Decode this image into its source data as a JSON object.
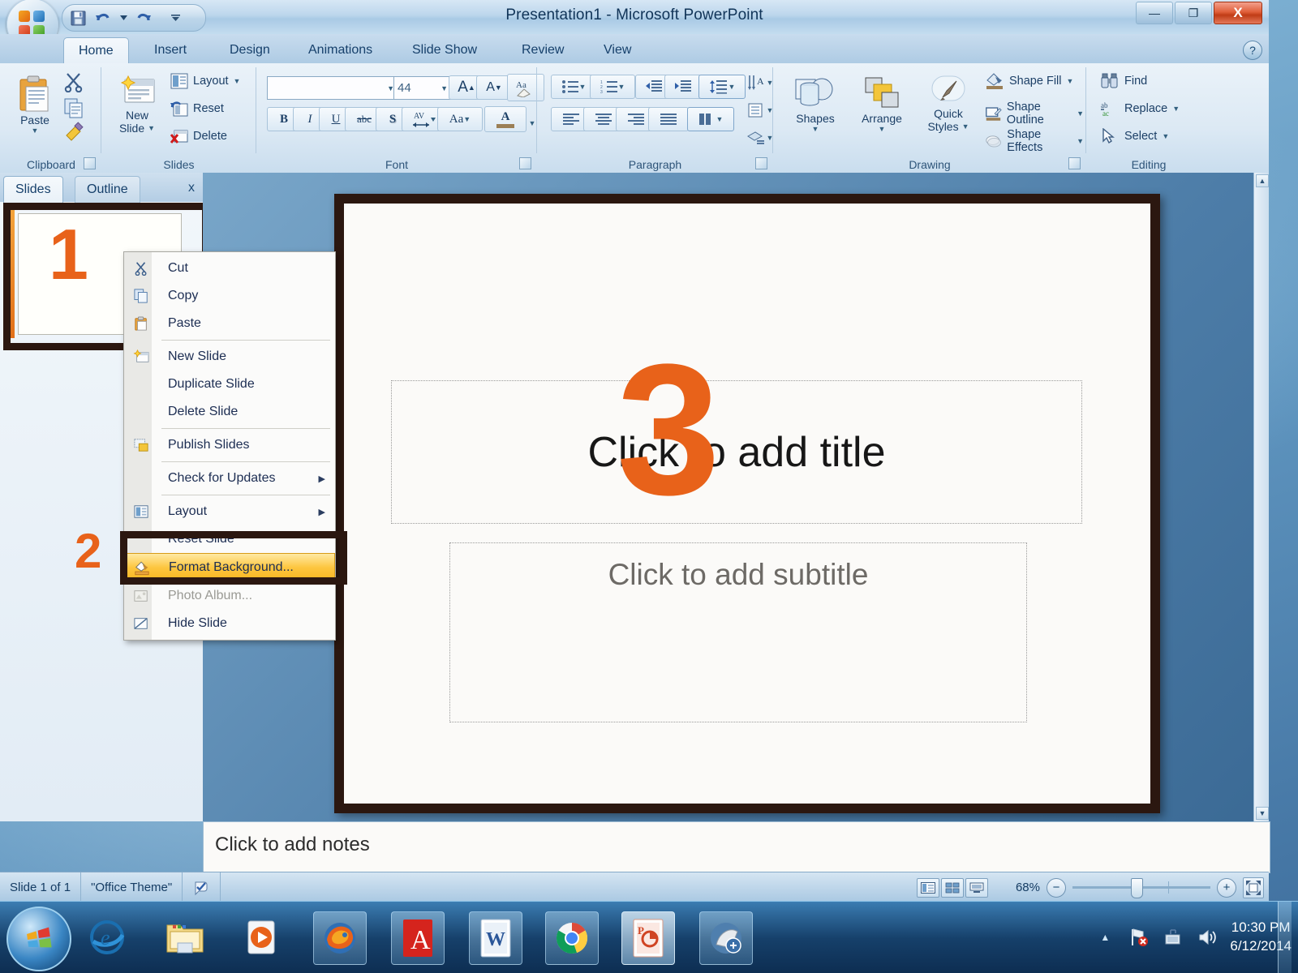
{
  "window": {
    "title": "Presentation1 - Microsoft PowerPoint",
    "minimize_label": "—",
    "restore_label": "❐",
    "close_label": "X",
    "help_label": "?"
  },
  "quick_access": {
    "items": [
      {
        "name": "save-icon",
        "label": "💾"
      },
      {
        "name": "undo-icon",
        "label": "↶"
      },
      {
        "name": "undo-dropdown-icon",
        "label": "▾"
      },
      {
        "name": "redo-icon",
        "label": "↷"
      },
      {
        "name": "customize-qat-icon",
        "label": "▾"
      }
    ]
  },
  "ribbon": {
    "tabs": [
      {
        "label": "Home",
        "active": true
      },
      {
        "label": "Insert",
        "active": false
      },
      {
        "label": "Design",
        "active": false
      },
      {
        "label": "Animations",
        "active": false
      },
      {
        "label": "Slide Show",
        "active": false
      },
      {
        "label": "Review",
        "active": false
      },
      {
        "label": "View",
        "active": false
      }
    ],
    "groups": {
      "clipboard": {
        "label": "Clipboard",
        "paste_label": "Paste",
        "cut_label": "Cut",
        "copy_label": "Copy",
        "format_painter_label": "Format Painter"
      },
      "slides": {
        "label": "Slides",
        "new_slide_line1": "New",
        "new_slide_line2": "Slide",
        "layout_label": "Layout",
        "reset_label": "Reset",
        "delete_label": "Delete"
      },
      "font": {
        "label": "Font",
        "font_name_value": "",
        "font_name_placeholder": "",
        "font_size_value": "44",
        "grow_font_label": "A",
        "shrink_font_label": "A",
        "clear_formatting_label": "Aa",
        "bold_label": "B",
        "italic_label": "I",
        "underline_label": "U",
        "strikethrough_label": "abc",
        "shadow_label": "S",
        "spacing_label": "AV",
        "change_case_label": "Aa",
        "font_color_label": "A"
      },
      "paragraph": {
        "label": "Paragraph"
      },
      "drawing": {
        "label": "Drawing",
        "shapes_label": "Shapes",
        "arrange_label": "Arrange",
        "quick_styles_line1": "Quick",
        "quick_styles_line2": "Styles",
        "shape_fill_label": "Shape Fill",
        "shape_outline_label": "Shape Outline",
        "shape_effects_label": "Shape Effects"
      },
      "editing": {
        "label": "Editing",
        "find_label": "Find",
        "replace_label": "Replace",
        "select_label": "Select"
      }
    }
  },
  "slide_panel": {
    "tabs": [
      {
        "label": "Slides",
        "active": true
      },
      {
        "label": "Outline",
        "active": false
      }
    ],
    "close_label": "x",
    "thumbnail_number": "1"
  },
  "context_menu": {
    "items": [
      {
        "label": "Cut",
        "icon": "scissors-icon",
        "glyph": "✂",
        "separator_after": false,
        "highlight": false,
        "submenu": false,
        "dim": false
      },
      {
        "label": "Copy",
        "icon": "copy-icon",
        "glyph": "⧉",
        "separator_after": false,
        "highlight": false,
        "submenu": false,
        "dim": false
      },
      {
        "label": "Paste",
        "icon": "paste-icon",
        "glyph": "📋",
        "separator_after": true,
        "highlight": false,
        "submenu": false,
        "dim": false
      },
      {
        "label": "New Slide",
        "icon": "new-slide-icon",
        "glyph": "❖",
        "separator_after": false,
        "highlight": false,
        "submenu": false,
        "dim": false
      },
      {
        "label": "Duplicate Slide",
        "icon": "",
        "glyph": "",
        "separator_after": false,
        "highlight": false,
        "submenu": false,
        "dim": false
      },
      {
        "label": "Delete Slide",
        "icon": "",
        "glyph": "",
        "separator_after": true,
        "highlight": false,
        "submenu": false,
        "dim": false
      },
      {
        "label": "Publish Slides",
        "icon": "publish-slides-icon",
        "glyph": "▤",
        "separator_after": true,
        "highlight": false,
        "submenu": false,
        "dim": false
      },
      {
        "label": "Check for Updates",
        "icon": "",
        "glyph": "",
        "separator_after": true,
        "highlight": false,
        "submenu": true,
        "dim": false
      },
      {
        "label": "Layout",
        "icon": "layout-icon",
        "glyph": "▥",
        "separator_after": false,
        "highlight": false,
        "submenu": true,
        "dim": false
      },
      {
        "label": "Reset Slide",
        "icon": "",
        "glyph": "",
        "separator_after": false,
        "highlight": false,
        "submenu": false,
        "dim": false
      },
      {
        "label": "Format Background...",
        "icon": "format-background-icon",
        "glyph": "◢",
        "separator_after": false,
        "highlight": true,
        "submenu": false,
        "dim": false
      },
      {
        "label": "Photo Album...",
        "icon": "photo-album-icon",
        "glyph": "▨",
        "separator_after": false,
        "highlight": false,
        "submenu": false,
        "dim": true
      },
      {
        "label": "Hide Slide",
        "icon": "hide-slide-icon",
        "glyph": "◧",
        "separator_after": false,
        "highlight": false,
        "submenu": false,
        "dim": false
      }
    ]
  },
  "annotations": {
    "step1": "1",
    "step2": "2",
    "step3": "3",
    "color": "#e8621a"
  },
  "slide": {
    "title_placeholder": "Click to add title",
    "subtitle_placeholder": "Click to add subtitle"
  },
  "notes": {
    "placeholder": "Click to add notes"
  },
  "status_bar": {
    "slide_count": "Slide 1 of 1",
    "theme": "\"Office Theme\"",
    "spellcheck_icon": "spell-check-icon",
    "zoom_percent": "68%",
    "zoom_out_label": "−",
    "zoom_in_label": "+",
    "fit_label": "✥",
    "views": [
      {
        "name": "normal-view-button",
        "selected": false
      },
      {
        "name": "slide-sorter-view-button",
        "selected": false
      },
      {
        "name": "slide-show-view-button",
        "selected": false
      }
    ]
  },
  "taskbar": {
    "start_label": "Start",
    "items": [
      {
        "name": "taskbar-internet-explorer",
        "state": "pinned"
      },
      {
        "name": "taskbar-windows-explorer",
        "state": "pinned"
      },
      {
        "name": "taskbar-media-player",
        "state": "pinned"
      },
      {
        "name": "taskbar-firefox",
        "state": "open"
      },
      {
        "name": "taskbar-adobe-reader",
        "state": "open"
      },
      {
        "name": "taskbar-word",
        "state": "open"
      },
      {
        "name": "taskbar-chrome",
        "state": "open"
      },
      {
        "name": "taskbar-powerpoint",
        "state": "active"
      },
      {
        "name": "taskbar-unknown-app",
        "state": "open"
      }
    ],
    "tray": {
      "show_hidden_label": "▲",
      "network_icon": "network-error-icon",
      "action_center_icon": "action-center-icon",
      "volume_icon": "volume-icon",
      "time": "10:30 PM",
      "date": "6/12/2014"
    }
  }
}
